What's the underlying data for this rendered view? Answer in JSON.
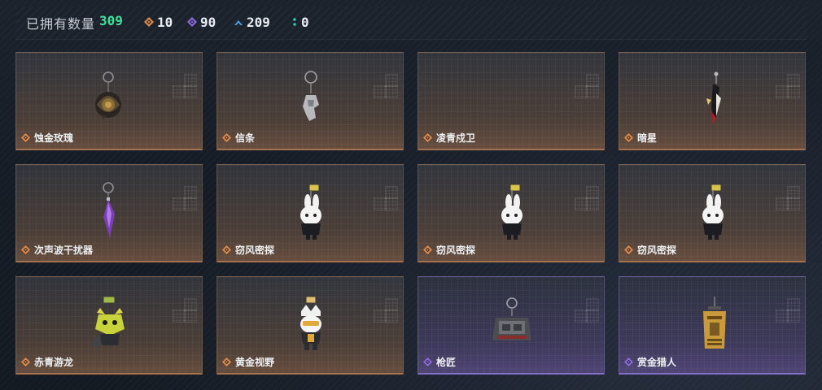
{
  "header": {
    "title": "已拥有数量",
    "total": "309",
    "stats": [
      {
        "icon": "orange-diamond-icon",
        "color": "#e08a4a",
        "value": "10"
      },
      {
        "icon": "purple-diamond-icon",
        "color": "#8b6adf",
        "value": "90"
      },
      {
        "icon": "blue-chevron-icon",
        "color": "#4aa0e0",
        "value": "209"
      },
      {
        "icon": "teal-dots-icon",
        "color": "#2ac9b0",
        "value": "0"
      }
    ]
  },
  "rarity_colors": {
    "orange": "#e08a4a",
    "purple": "#8b6adf"
  },
  "cards": [
    {
      "name": "蚀金玫瑰",
      "rarity": "orange",
      "icon": "gold-rose-charm-icon"
    },
    {
      "name": "信条",
      "rarity": "orange",
      "icon": "creed-charm-icon"
    },
    {
      "name": "凌青戍卫",
      "rarity": "orange",
      "icon": "empty-slot-icon"
    },
    {
      "name": "暗星",
      "rarity": "orange",
      "icon": "dark-star-charm-icon"
    },
    {
      "name": "次声波干扰器",
      "rarity": "orange",
      "icon": "purple-crystal-charm-icon"
    },
    {
      "name": "窃风密探",
      "rarity": "orange",
      "icon": "white-bunny-charm-icon"
    },
    {
      "name": "窃风密探",
      "rarity": "orange",
      "icon": "white-bunny-charm-icon"
    },
    {
      "name": "窃风密探",
      "rarity": "orange",
      "icon": "white-bunny-charm-icon"
    },
    {
      "name": "赤青游龙",
      "rarity": "orange",
      "icon": "green-dragon-charm-icon"
    },
    {
      "name": "黄金视野",
      "rarity": "orange",
      "icon": "golden-vision-charm-icon"
    },
    {
      "name": "枪匠",
      "rarity": "purple",
      "icon": "gunsmith-charm-icon"
    },
    {
      "name": "赏金猎人",
      "rarity": "purple",
      "icon": "bounty-poster-charm-icon"
    }
  ]
}
